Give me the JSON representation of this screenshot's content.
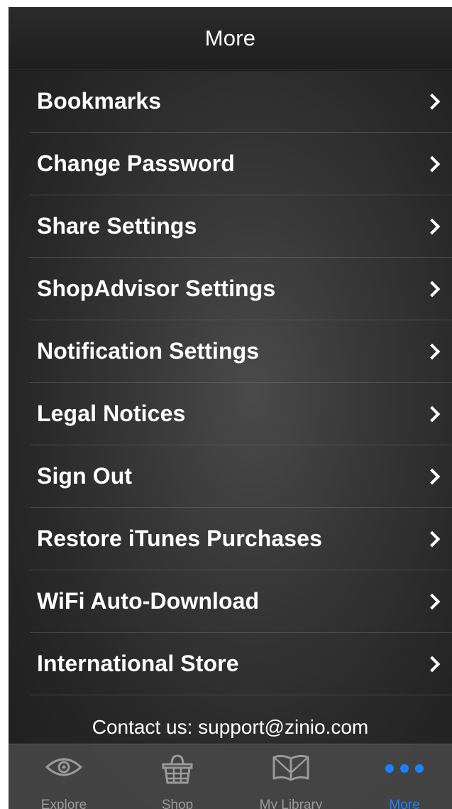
{
  "header": {
    "title": "More"
  },
  "menu": {
    "items": [
      {
        "label": "Bookmarks"
      },
      {
        "label": "Change Password"
      },
      {
        "label": "Share Settings"
      },
      {
        "label": "ShopAdvisor Settings"
      },
      {
        "label": "Notification Settings"
      },
      {
        "label": "Legal Notices"
      },
      {
        "label": "Sign Out"
      },
      {
        "label": "Restore iTunes Purchases"
      },
      {
        "label": "WiFi Auto-Download"
      },
      {
        "label": "International Store"
      }
    ]
  },
  "footer": {
    "contact": "Contact us: support@zinio.com"
  },
  "tabbar": {
    "tabs": [
      {
        "label": "Explore",
        "icon": "eye-icon"
      },
      {
        "label": "Shop",
        "icon": "basket-icon"
      },
      {
        "label": "My Library",
        "icon": "open-book-icon"
      },
      {
        "label": "More",
        "icon": "more-dots-icon",
        "active": true
      }
    ]
  },
  "colors": {
    "accent": "#1a82ff",
    "inactive_tab": "#9a9a9a",
    "text": "#ffffff"
  }
}
